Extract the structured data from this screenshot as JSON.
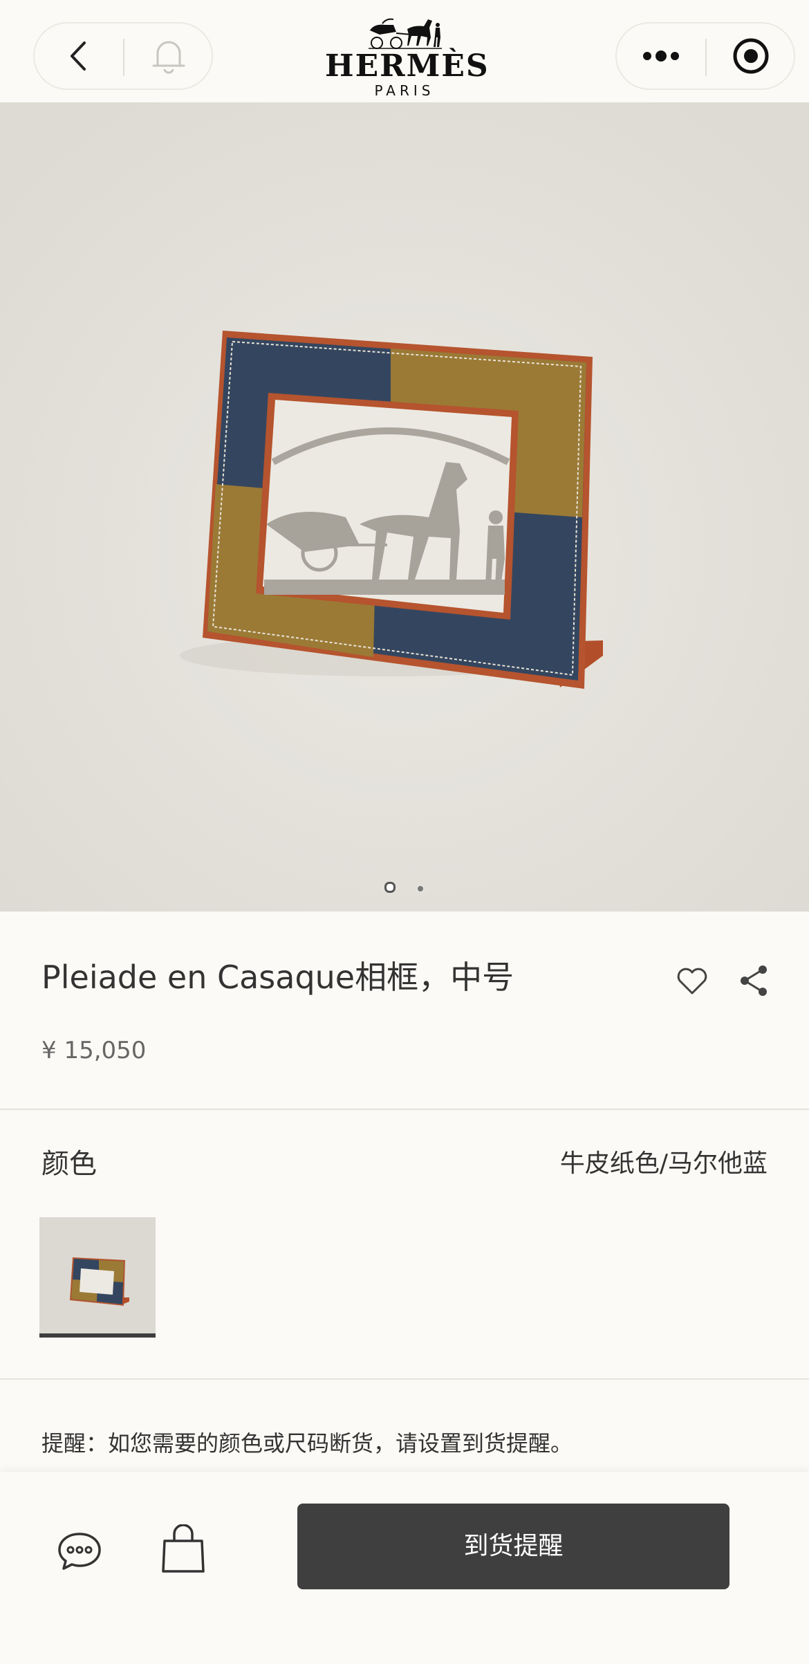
{
  "header": {
    "brand": "HERMÈS",
    "brand_sub": "PARIS"
  },
  "hero": {
    "image_count": 2,
    "active_index": 0
  },
  "product": {
    "title": "Pleiade en Casaque相框，中号",
    "price": "¥ 15,050"
  },
  "color": {
    "label": "颜色",
    "selected_value": "牛皮纸色/马尔他蓝"
  },
  "notice": "提醒：如您需要的颜色或尺码断货，请设置到货提醒。",
  "footer": {
    "cta_label": "到货提醒"
  },
  "colors": {
    "background": "#fcfaf6",
    "cta": "#3f3f3f",
    "frame_blue": "#34465f",
    "frame_tan": "#9b7a36",
    "frame_wood": "#b5542e"
  },
  "icons": {
    "back": "chevron-left-icon",
    "bell": "bell-icon",
    "more": "more-dots-icon",
    "record": "target-icon",
    "favorite": "heart-icon",
    "share": "share-icon",
    "chat": "chat-bubble-icon",
    "bag": "shopping-bag-icon"
  }
}
